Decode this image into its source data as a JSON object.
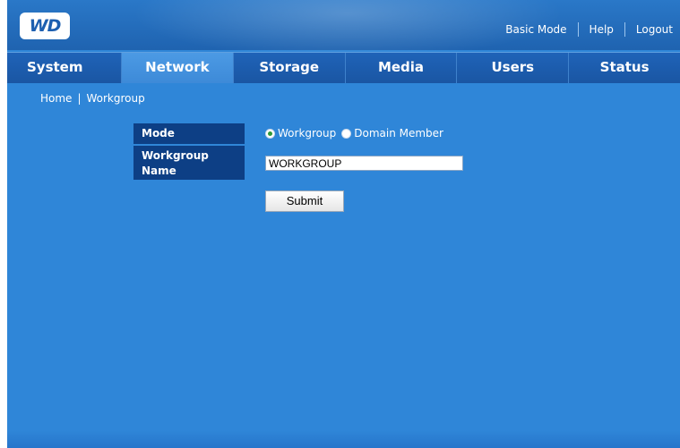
{
  "header": {
    "logo_text": "WD",
    "links": [
      "Basic Mode",
      "Help",
      "Logout"
    ]
  },
  "nav": {
    "tabs": [
      {
        "label": "System",
        "active": false
      },
      {
        "label": "Network",
        "active": true
      },
      {
        "label": "Storage",
        "active": false
      },
      {
        "label": "Media",
        "active": false
      },
      {
        "label": "Users",
        "active": false
      },
      {
        "label": "Status",
        "active": false
      }
    ]
  },
  "breadcrumb": {
    "home": "Home",
    "separator": "|",
    "current": "Workgroup"
  },
  "form": {
    "mode_label": "Mode",
    "mode_options": [
      {
        "label": "Workgroup",
        "selected": true
      },
      {
        "label": "Domain Member",
        "selected": false
      }
    ],
    "workgroup_label_line1": "Workgroup",
    "workgroup_label_line2": "Name",
    "workgroup_value": "WORKGROUP",
    "submit_label": "Submit"
  },
  "colors": {
    "background": "#2f86d8",
    "nav": "#1f63b8",
    "active_tab": "#3d8ad8",
    "label_bg": "#0d3f85",
    "radio_selected": "#2e9a3a"
  }
}
